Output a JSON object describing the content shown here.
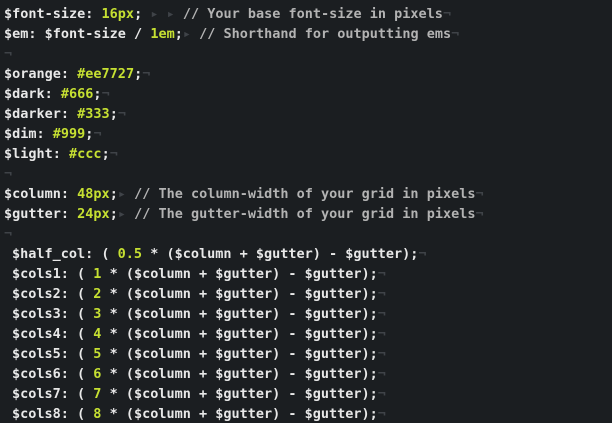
{
  "lines": [
    {
      "parts": [
        {
          "t": "$font-size",
          "c": "var"
        },
        {
          "t": ": ",
          "c": "tok"
        },
        {
          "t": "16px",
          "c": "num"
        },
        {
          "t": "; ",
          "c": "tok"
        },
        {
          "t": "▸ ▸ ",
          "c": "invis"
        },
        {
          "t": "// Your base font-size in pixels",
          "c": "comment"
        },
        {
          "t": "¬",
          "c": "invis"
        }
      ]
    },
    {
      "parts": [
        {
          "t": "$em",
          "c": "var"
        },
        {
          "t": ": ",
          "c": "tok"
        },
        {
          "t": "$font-size / ",
          "c": "tok"
        },
        {
          "t": "1em",
          "c": "num"
        },
        {
          "t": ";",
          "c": "tok"
        },
        {
          "t": "▸ ",
          "c": "invis"
        },
        {
          "t": "// Shorthand for outputting ems",
          "c": "comment"
        },
        {
          "t": "¬",
          "c": "invis"
        }
      ]
    },
    {
      "parts": [
        {
          "t": "¬",
          "c": "invis"
        }
      ]
    },
    {
      "parts": [
        {
          "t": "$orange",
          "c": "var"
        },
        {
          "t": ": ",
          "c": "tok"
        },
        {
          "t": "#ee7727",
          "c": "num"
        },
        {
          "t": ";",
          "c": "tok"
        },
        {
          "t": "¬",
          "c": "invis"
        }
      ]
    },
    {
      "parts": [
        {
          "t": "$dark",
          "c": "var"
        },
        {
          "t": ": ",
          "c": "tok"
        },
        {
          "t": "#666",
          "c": "num"
        },
        {
          "t": ";",
          "c": "tok"
        },
        {
          "t": "¬",
          "c": "invis"
        }
      ]
    },
    {
      "parts": [
        {
          "t": "$darker",
          "c": "var"
        },
        {
          "t": ": ",
          "c": "tok"
        },
        {
          "t": "#333",
          "c": "num"
        },
        {
          "t": ";",
          "c": "tok"
        },
        {
          "t": "¬",
          "c": "invis"
        }
      ]
    },
    {
      "parts": [
        {
          "t": "$dim",
          "c": "var"
        },
        {
          "t": ": ",
          "c": "tok"
        },
        {
          "t": "#999",
          "c": "num"
        },
        {
          "t": ";",
          "c": "tok"
        },
        {
          "t": "¬",
          "c": "invis"
        }
      ]
    },
    {
      "parts": [
        {
          "t": "$light",
          "c": "var"
        },
        {
          "t": ": ",
          "c": "tok"
        },
        {
          "t": "#ccc",
          "c": "num"
        },
        {
          "t": ";",
          "c": "tok"
        },
        {
          "t": "¬",
          "c": "invis"
        }
      ]
    },
    {
      "parts": [
        {
          "t": "¬",
          "c": "invis"
        }
      ]
    },
    {
      "parts": [
        {
          "t": "$column",
          "c": "var"
        },
        {
          "t": ": ",
          "c": "tok"
        },
        {
          "t": "48px",
          "c": "num"
        },
        {
          "t": ";",
          "c": "tok"
        },
        {
          "t": "▸ ",
          "c": "invis"
        },
        {
          "t": "// The column-width of your grid in pixels",
          "c": "comment"
        },
        {
          "t": "¬",
          "c": "invis"
        }
      ]
    },
    {
      "parts": [
        {
          "t": "$gutter",
          "c": "var"
        },
        {
          "t": ": ",
          "c": "tok"
        },
        {
          "t": "24px",
          "c": "num"
        },
        {
          "t": ";",
          "c": "tok"
        },
        {
          "t": "▸ ",
          "c": "invis"
        },
        {
          "t": "// The gutter-width of your grid in pixels",
          "c": "comment"
        },
        {
          "t": "¬",
          "c": "invis"
        }
      ]
    },
    {
      "parts": [
        {
          "t": "¬",
          "c": "invis"
        }
      ]
    },
    {
      "indent": true,
      "parts": [
        {
          "t": "$half_col",
          "c": "var"
        },
        {
          "t": ": ( ",
          "c": "tok"
        },
        {
          "t": "0.5",
          "c": "num"
        },
        {
          "t": " * ($column + $gutter) - $gutter);",
          "c": "tok"
        },
        {
          "t": "¬",
          "c": "invis"
        }
      ]
    },
    {
      "indent": true,
      "parts": [
        {
          "t": "$cols1",
          "c": "var"
        },
        {
          "t": ": ( ",
          "c": "tok"
        },
        {
          "t": "1",
          "c": "num"
        },
        {
          "t": " * ($column + $gutter) - $gutter);",
          "c": "tok"
        },
        {
          "t": "¬",
          "c": "invis"
        }
      ]
    },
    {
      "indent": true,
      "parts": [
        {
          "t": "$cols2",
          "c": "var"
        },
        {
          "t": ": ( ",
          "c": "tok"
        },
        {
          "t": "2",
          "c": "num"
        },
        {
          "t": " * ($column + $gutter) - $gutter);",
          "c": "tok"
        },
        {
          "t": "¬",
          "c": "invis"
        }
      ]
    },
    {
      "indent": true,
      "parts": [
        {
          "t": "$cols3",
          "c": "var"
        },
        {
          "t": ": ( ",
          "c": "tok"
        },
        {
          "t": "3",
          "c": "num"
        },
        {
          "t": " * ($column + $gutter) - $gutter);",
          "c": "tok"
        },
        {
          "t": "¬",
          "c": "invis"
        }
      ]
    },
    {
      "indent": true,
      "parts": [
        {
          "t": "$cols4",
          "c": "var"
        },
        {
          "t": ": ( ",
          "c": "tok"
        },
        {
          "t": "4",
          "c": "num"
        },
        {
          "t": " * ($column + $gutter) - $gutter);",
          "c": "tok"
        },
        {
          "t": "¬",
          "c": "invis"
        }
      ]
    },
    {
      "indent": true,
      "parts": [
        {
          "t": "$cols5",
          "c": "var"
        },
        {
          "t": ": ( ",
          "c": "tok"
        },
        {
          "t": "5",
          "c": "num"
        },
        {
          "t": " * ($column + $gutter) - $gutter);",
          "c": "tok"
        },
        {
          "t": "¬",
          "c": "invis"
        }
      ]
    },
    {
      "indent": true,
      "parts": [
        {
          "t": "$cols6",
          "c": "var"
        },
        {
          "t": ": ( ",
          "c": "tok"
        },
        {
          "t": "6",
          "c": "num"
        },
        {
          "t": " * ($column + $gutter) - $gutter);",
          "c": "tok"
        },
        {
          "t": "¬",
          "c": "invis"
        }
      ]
    },
    {
      "indent": true,
      "parts": [
        {
          "t": "$cols7",
          "c": "var"
        },
        {
          "t": ": ( ",
          "c": "tok"
        },
        {
          "t": "7",
          "c": "num"
        },
        {
          "t": " * ($column + $gutter) - $gutter);",
          "c": "tok"
        },
        {
          "t": "¬",
          "c": "invis"
        }
      ]
    },
    {
      "indent": true,
      "parts": [
        {
          "t": "$cols8",
          "c": "var"
        },
        {
          "t": ": ( ",
          "c": "tok"
        },
        {
          "t": "8",
          "c": "num"
        },
        {
          "t": " * ($column + $gutter) - $gutter);",
          "c": "tok"
        },
        {
          "t": "¬",
          "c": "invis"
        }
      ]
    }
  ]
}
